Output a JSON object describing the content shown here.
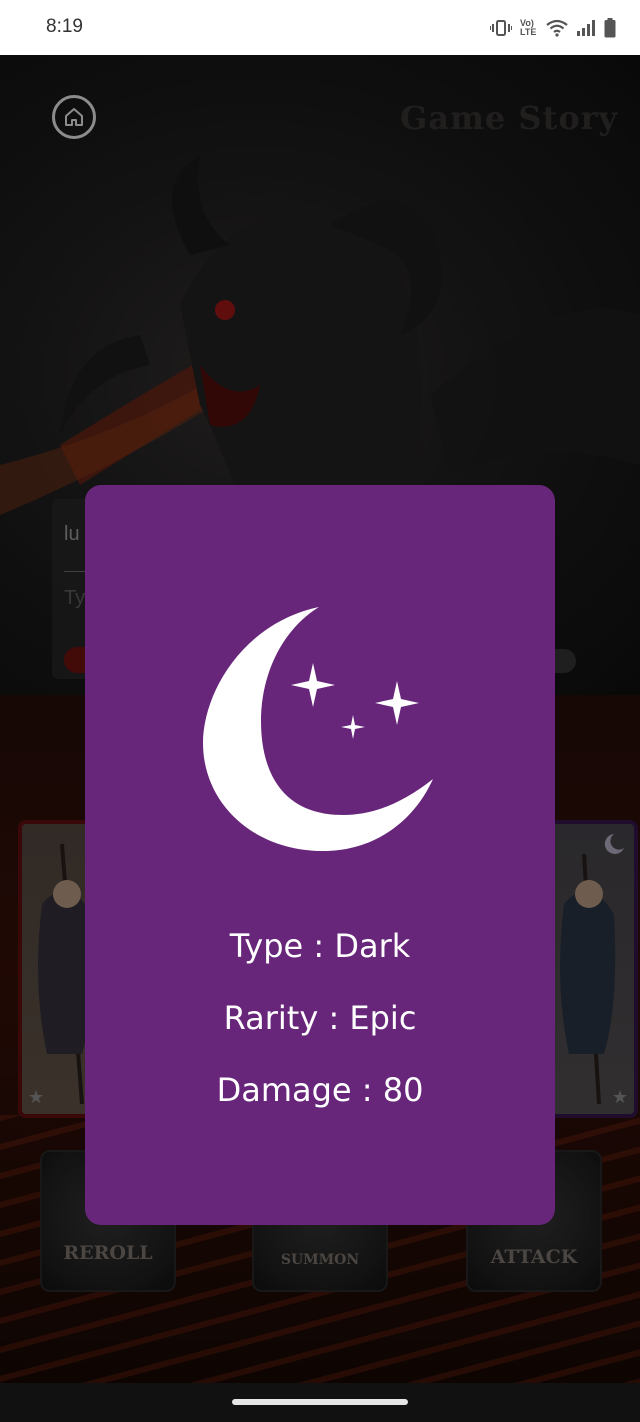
{
  "status_bar": {
    "time": "8:19",
    "icons": [
      "vibrate-icon",
      "volte-icon",
      "wifi-icon",
      "signal-icon",
      "battery-icon"
    ],
    "volte_text": "Vo) LTE"
  },
  "header": {
    "home_icon": "home-icon",
    "title": "Game Story"
  },
  "chat": {
    "message_text": "lu",
    "input_placeholder": "Ty"
  },
  "buttons": {
    "reroll": "REROLL",
    "summon": "SUMMON",
    "attack": "ATTACK"
  },
  "modal": {
    "icon": "moon-stars-icon",
    "type_line": "Type : Dark",
    "rarity_line": "Rarity : Epic",
    "damage_line": "Damage : 80",
    "background_color": "#67267a"
  },
  "colors": {
    "modal": "#67267a",
    "text": "#ffffff"
  }
}
